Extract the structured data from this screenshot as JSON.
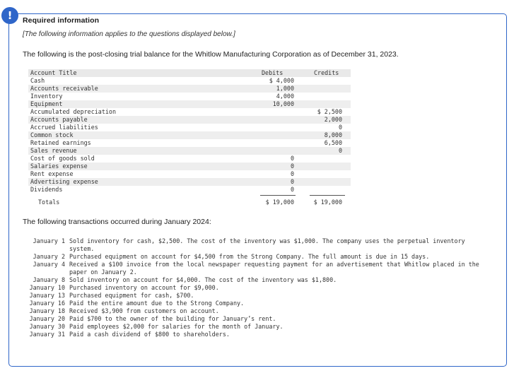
{
  "alert": {
    "icon": "exclamation-icon",
    "symbol": "!"
  },
  "heading": "Required information",
  "note": "[The following information applies to the questions displayed below.]",
  "intro": "The following is the post-closing trial balance for the Whitlow Manufacturing Corporation as of December 31, 2023.",
  "trial_balance": {
    "headers": {
      "account": "Account Title",
      "debits": "Debits",
      "credits": "Credits"
    },
    "rows": [
      {
        "account": "Cash",
        "debit": "$ 4,000",
        "credit": ""
      },
      {
        "account": "Accounts receivable",
        "debit": "1,000",
        "credit": ""
      },
      {
        "account": "Inventory",
        "debit": "4,000",
        "credit": ""
      },
      {
        "account": "Equipment",
        "debit": "10,000",
        "credit": ""
      },
      {
        "account": "Accumulated depreciation",
        "debit": "",
        "credit": "$ 2,500"
      },
      {
        "account": "Accounts payable",
        "debit": "",
        "credit": "2,000"
      },
      {
        "account": "Accrued liabilities",
        "debit": "",
        "credit": "0"
      },
      {
        "account": "Common stock",
        "debit": "",
        "credit": "8,000"
      },
      {
        "account": "Retained earnings",
        "debit": "",
        "credit": "6,500"
      },
      {
        "account": "Sales revenue",
        "debit": "",
        "credit": "0"
      },
      {
        "account": "Cost of goods sold",
        "debit": "0",
        "credit": ""
      },
      {
        "account": "Salaries expense",
        "debit": "0",
        "credit": ""
      },
      {
        "account": "Rent expense",
        "debit": "0",
        "credit": ""
      },
      {
        "account": "Advertising expense",
        "debit": "0",
        "credit": ""
      },
      {
        "account": "Dividends",
        "debit": "0",
        "credit": ""
      }
    ],
    "totals": {
      "label": "Totals",
      "debit": "$ 19,000",
      "credit": "$ 19,000"
    }
  },
  "transactions_intro": "The following transactions occurred during January 2024:",
  "transactions": [
    {
      "date": "January 1",
      "text": "Sold inventory for cash, $2,500. The cost of the inventory was $1,000. The company uses the perpetual inventory system."
    },
    {
      "date": "January 2",
      "text": "Purchased equipment on account for $4,500 from the Strong Company. The full amount is due in 15 days."
    },
    {
      "date": "January 4",
      "text": "Received a $100 invoice from the local newspaper requesting payment for an advertisement that Whitlow placed in the paper on January 2."
    },
    {
      "date": "January 8",
      "text": "Sold inventory on account for $4,000. The cost of the inventory was $1,800."
    },
    {
      "date": "January 10",
      "text": "Purchased inventory on account for $9,000."
    },
    {
      "date": "January 13",
      "text": "Purchased equipment for cash, $700."
    },
    {
      "date": "January 16",
      "text": "Paid the entire amount due to the Strong Company."
    },
    {
      "date": "January 18",
      "text": "Received $3,900 from customers on account."
    },
    {
      "date": "January 20",
      "text": "Paid $700 to the owner of the building for January’s rent."
    },
    {
      "date": "January 30",
      "text": "Paid employees $2,000 for salaries for the month of January."
    },
    {
      "date": "January 31",
      "text": "Paid a cash dividend of $800 to shareholders."
    }
  ]
}
